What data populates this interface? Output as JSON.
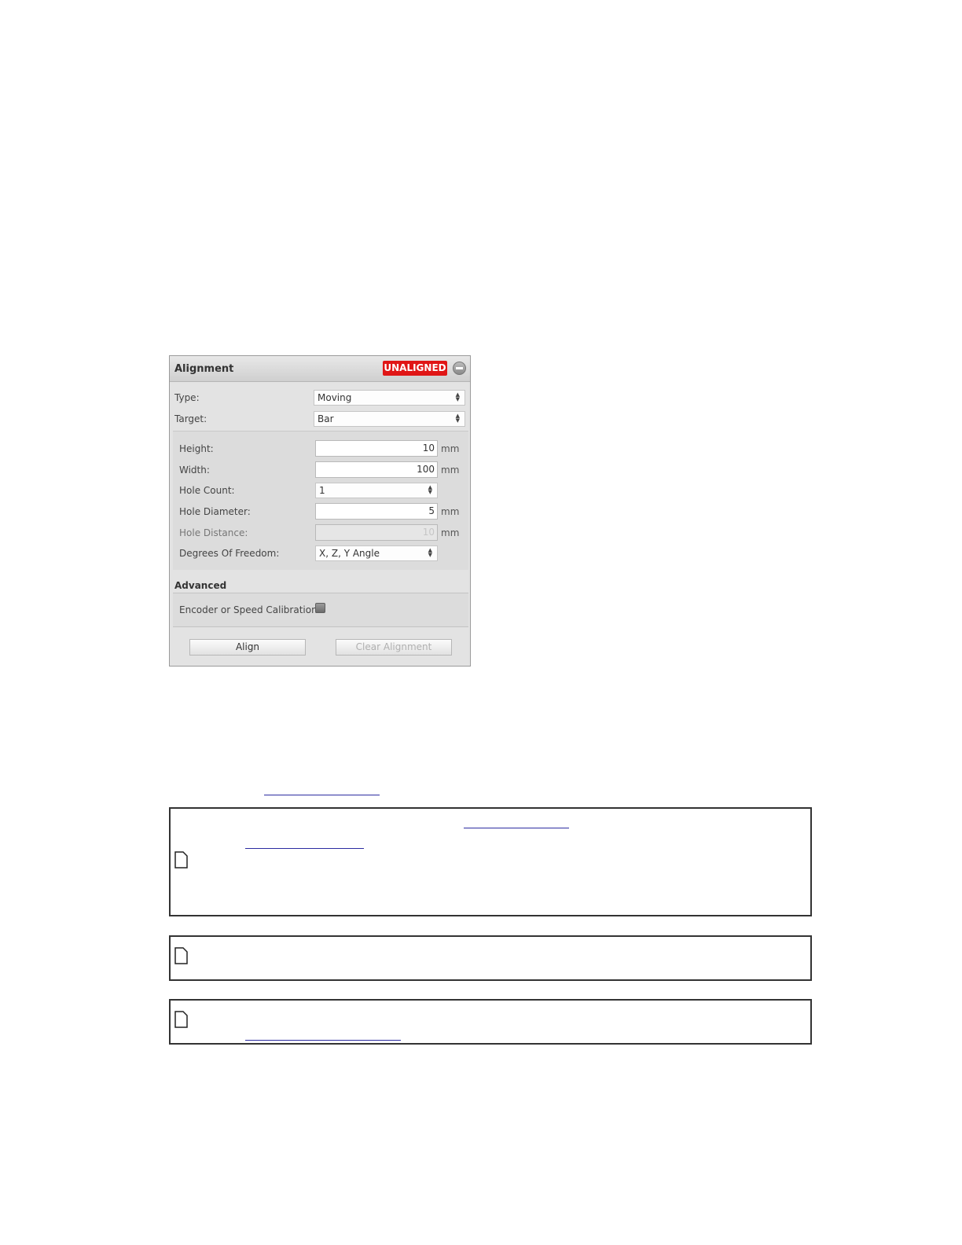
{
  "panel": {
    "title": "Alignment",
    "status_badge": "UNALIGNED",
    "type": {
      "label": "Type:",
      "value": "Moving"
    },
    "target": {
      "label": "Target:",
      "value": "Bar"
    },
    "height": {
      "label": "Height:",
      "value": "10",
      "unit": "mm"
    },
    "width": {
      "label": "Width:",
      "value": "100",
      "unit": "mm"
    },
    "hole_count": {
      "label": "Hole Count:",
      "value": "1"
    },
    "hole_diameter": {
      "label": "Hole Diameter:",
      "value": "5",
      "unit": "mm"
    },
    "hole_distance": {
      "label": "Hole Distance:",
      "value": "10",
      "unit": "mm"
    },
    "degrees_of_freedom": {
      "label": "Degrees Of Freedom:",
      "value": "X, Z, Y Angle"
    },
    "advanced": {
      "title": "Advanced",
      "encoder_label": "Encoder or Speed Calibration"
    },
    "buttons": {
      "align": "Align",
      "clear_alignment": "Clear Alignment"
    }
  },
  "icons": {
    "note": "note-icon",
    "collapse": "minus-circle-icon",
    "select_arrows": "up-down-arrow-icon"
  },
  "colors": {
    "status_badge": "#e01616",
    "link": "#2c2ca0"
  }
}
